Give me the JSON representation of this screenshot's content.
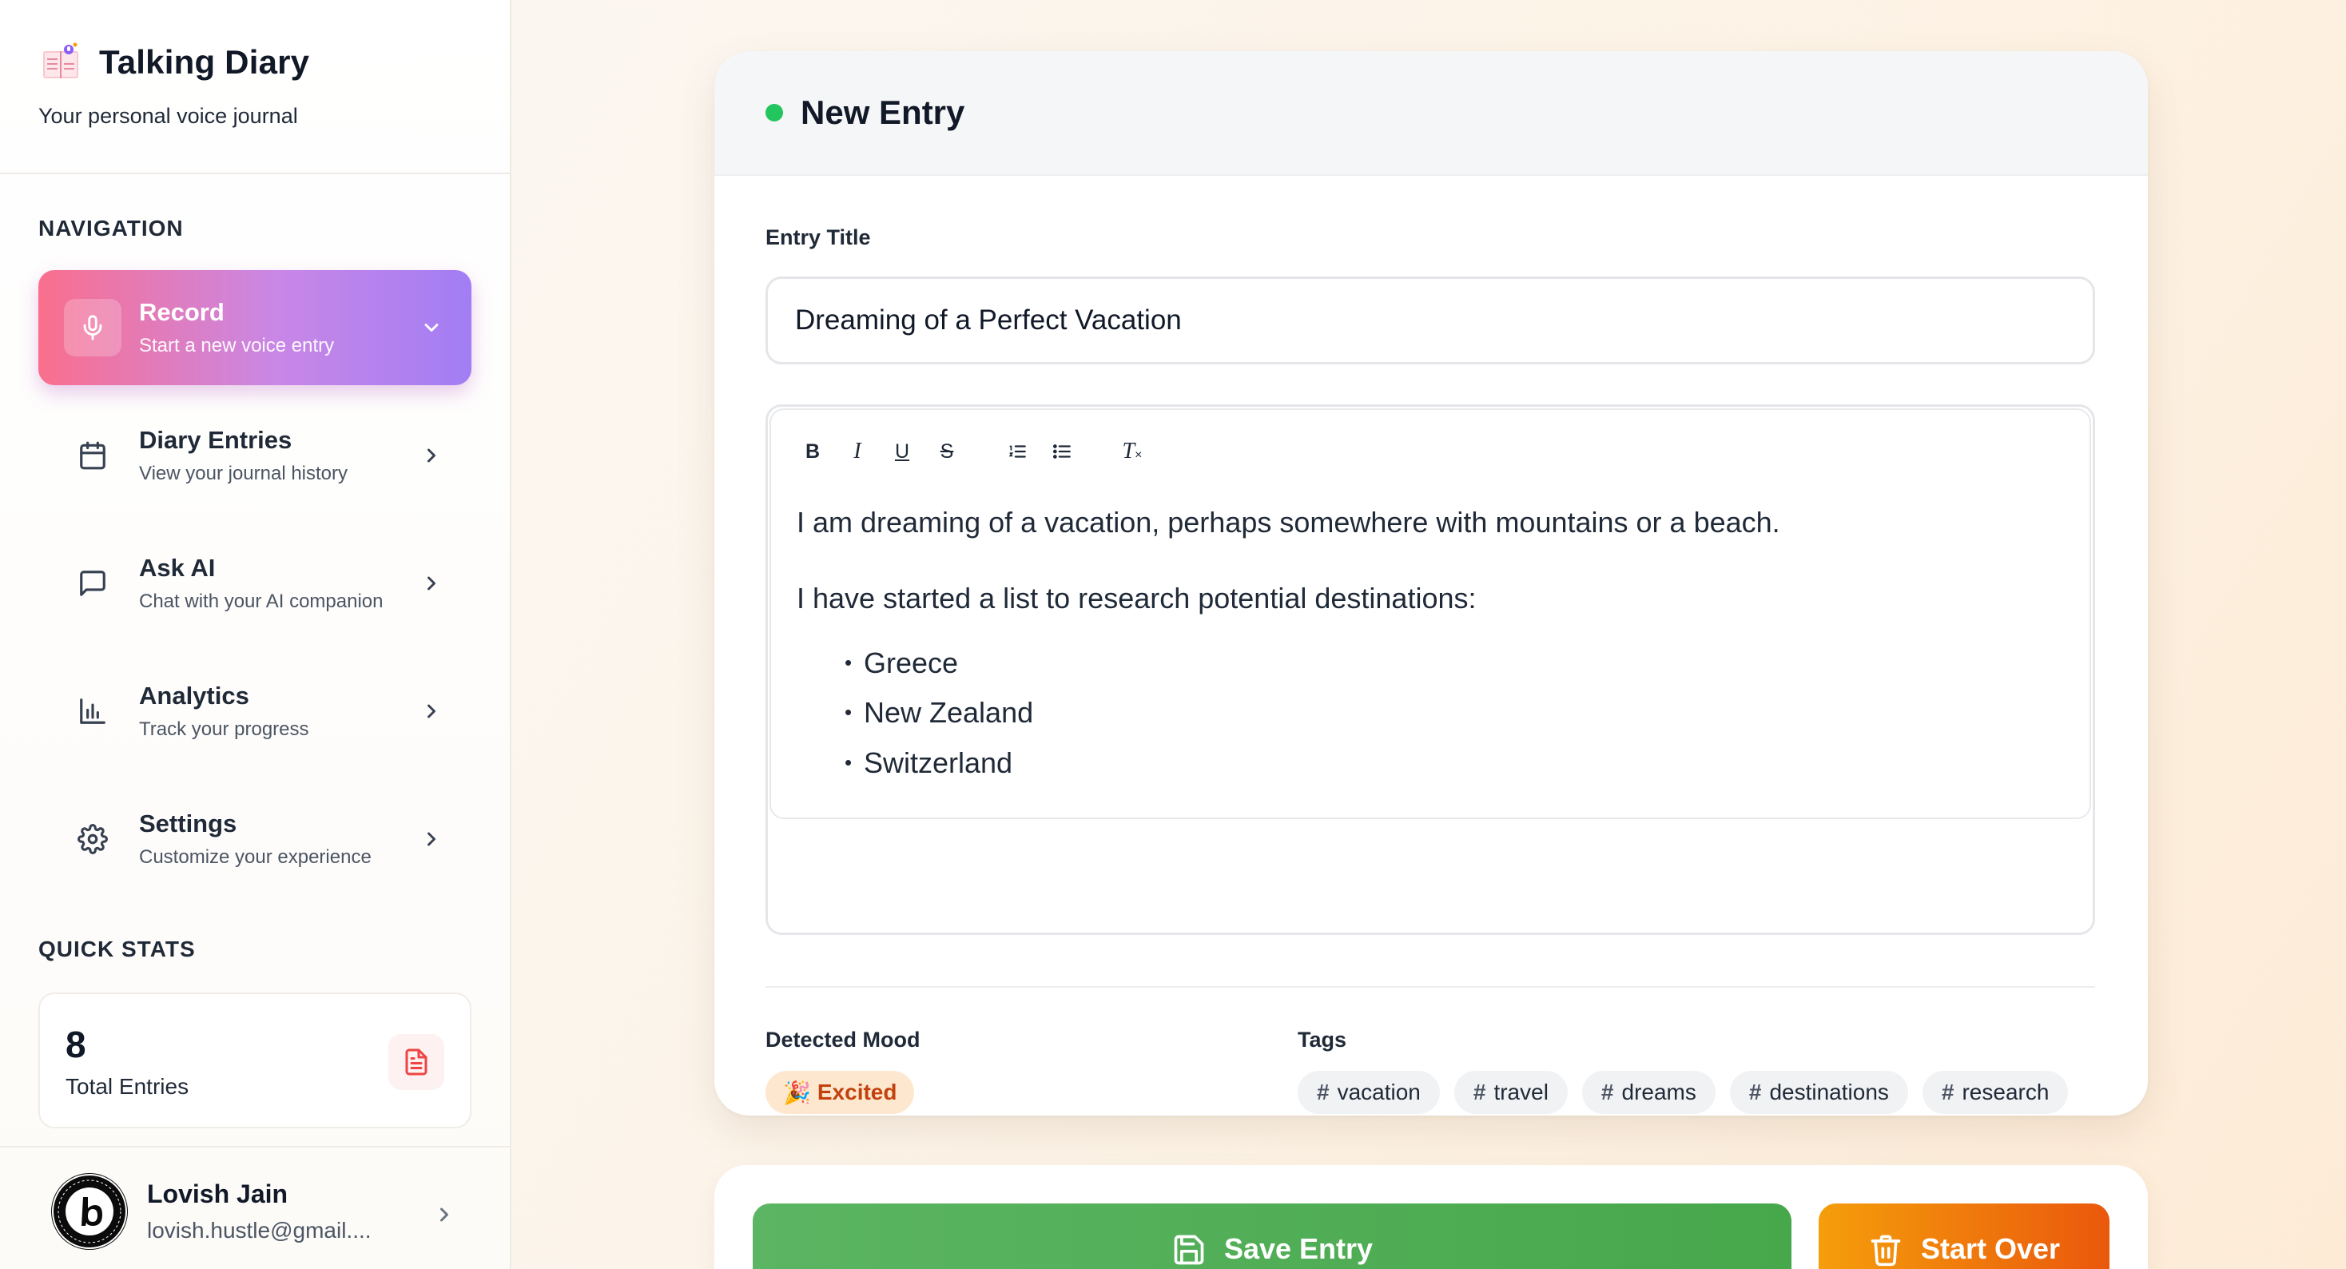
{
  "app": {
    "title": "Talking Diary",
    "subtitle": "Your personal voice journal"
  },
  "sidebar": {
    "nav_title": "NAVIGATION",
    "items": [
      {
        "label": "Record",
        "desc": "Start a new voice entry",
        "icon": "microphone-icon",
        "active": true
      },
      {
        "label": "Diary Entries",
        "desc": "View your journal history",
        "icon": "calendar-icon",
        "active": false
      },
      {
        "label": "Ask AI",
        "desc": "Chat with your AI companion",
        "icon": "chat-bubble-icon",
        "active": false
      },
      {
        "label": "Analytics",
        "desc": "Track your progress",
        "icon": "bar-chart-icon",
        "active": false
      },
      {
        "label": "Settings",
        "desc": "Customize your experience",
        "icon": "gear-icon",
        "active": false
      }
    ],
    "stats_title": "QUICK STATS",
    "stats": {
      "value": "8",
      "label": "Total Entries",
      "icon": "document-icon"
    },
    "user": {
      "name": "Lovish Jain",
      "email": "lovish.hustle@gmail...."
    }
  },
  "editor": {
    "header_title": "New Entry",
    "status_color": "#22c55e",
    "title_label": "Entry Title",
    "title_value": "Dreaming of a Perfect Vacation",
    "toolbar": {
      "bold": "B",
      "italic": "I",
      "underline": "U",
      "strike": "S",
      "clear": "T"
    },
    "paragraphs": [
      "I am dreaming of a vacation, perhaps somewhere with mountains or a beach.",
      "I have started a list to research potential destinations:"
    ],
    "list": [
      "Greece",
      "New Zealand",
      "Switzerland"
    ],
    "mood_label": "Detected Mood",
    "mood_emoji": "🎉",
    "mood": "Excited",
    "tags_label": "Tags",
    "tags": [
      "vacation",
      "travel",
      "dreams",
      "destinations",
      "research"
    ]
  },
  "actions": {
    "save_label": "Save Entry",
    "start_over_label": "Start Over"
  },
  "colors": {
    "accent_gradient_start": "#fa6f8d",
    "accent_gradient_end": "#a27df4",
    "save": "#47a74b",
    "start_over": "#ea580c"
  }
}
